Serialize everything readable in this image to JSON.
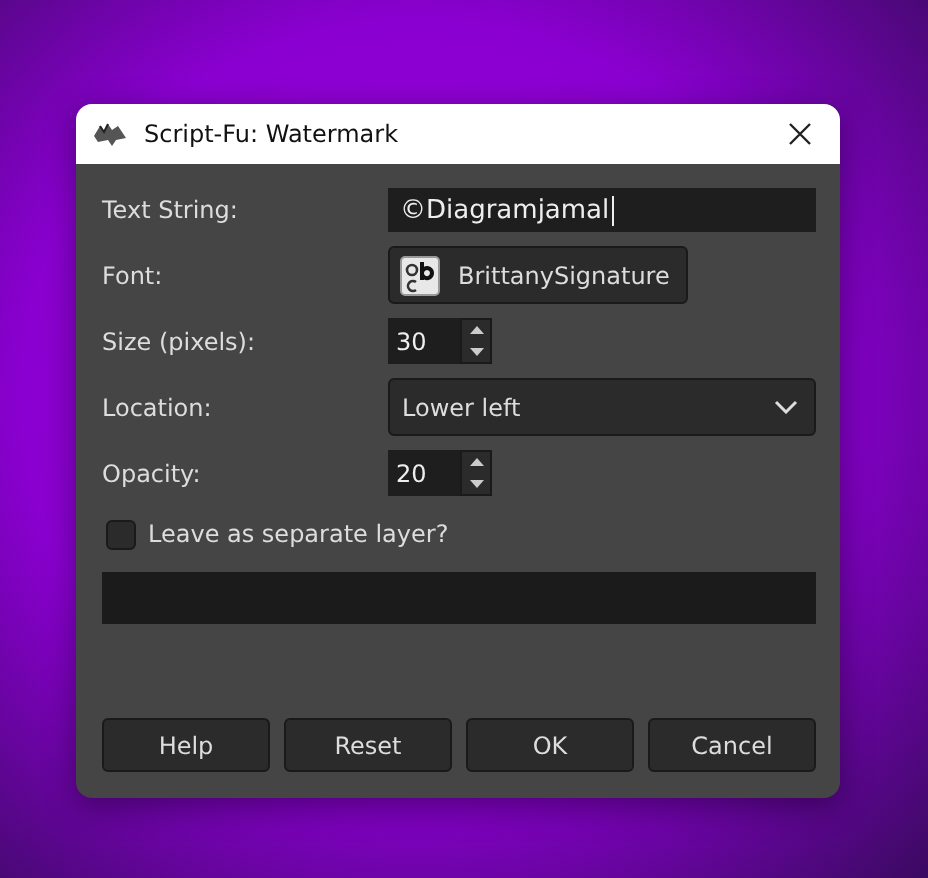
{
  "window": {
    "title": "Script-Fu: Watermark"
  },
  "fields": [
    {
      "kind": "text",
      "label": "Text String:",
      "value": "©Diagramjamal"
    },
    {
      "kind": "font",
      "label": "Font:",
      "value": "BrittanySignature"
    },
    {
      "kind": "spin",
      "label": "Size (pixels):",
      "value": "30"
    },
    {
      "kind": "select",
      "label": "Location:",
      "value": "Lower left"
    },
    {
      "kind": "spin",
      "label": "Opacity:",
      "value": "20"
    }
  ],
  "checkbox": {
    "label": "Leave as separate layer?",
    "checked": false
  },
  "buttons": [
    "Help",
    "Reset",
    "OK",
    "Cancel"
  ]
}
